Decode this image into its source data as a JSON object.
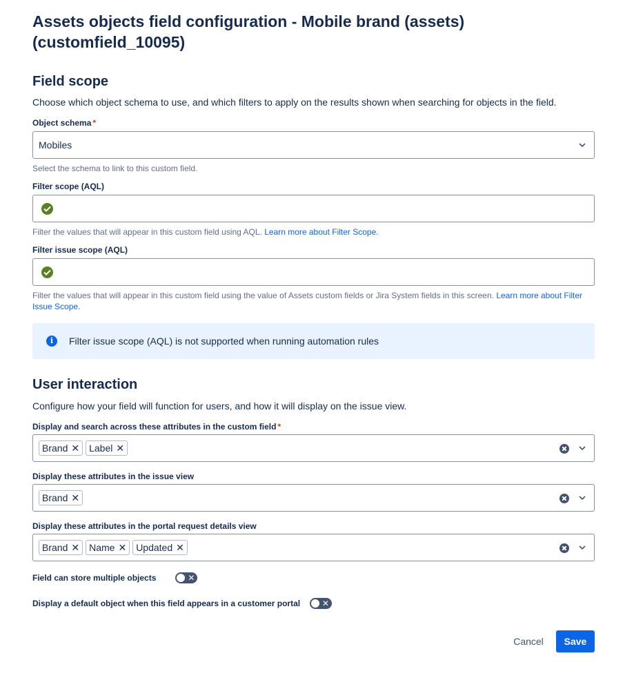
{
  "page": {
    "title": "Assets objects field configuration - Mobile brand (assets) (customfield_10095)"
  },
  "field_scope": {
    "heading": "Field scope",
    "description": "Choose which object schema to use, and which filters to apply on the results shown when searching for objects in the field.",
    "object_schema": {
      "label": "Object schema",
      "required_mark": "*",
      "value": "Mobiles",
      "helper": "Select the schema to link to this custom field."
    },
    "filter_scope": {
      "label": "Filter scope (AQL)",
      "status_icon": "check-circle-icon",
      "helper": "Filter the values that will appear in this custom field using AQL.",
      "link": "Learn more about Filter Scope."
    },
    "filter_issue_scope": {
      "label": "Filter issue scope (AQL)",
      "status_icon": "check-circle-icon",
      "helper": "Filter the values that will appear in this custom field using the value of Assets custom fields or Jira System fields in this screen.",
      "link": "Learn more about Filter Issue Scope."
    },
    "info_message": "Filter issue scope (AQL) is not supported when running automation rules"
  },
  "user_interaction": {
    "heading": "User interaction",
    "description": "Configure how your field will function for users, and how it will display on the issue view.",
    "display_search": {
      "label": "Display and search across these attributes in the custom field",
      "required_mark": "*",
      "chips": [
        "Brand",
        "Label"
      ]
    },
    "issue_view": {
      "label": "Display these attributes in the issue view",
      "chips": [
        "Brand"
      ]
    },
    "portal_view": {
      "label": "Display these attributes in the portal request details view",
      "chips": [
        "Brand",
        "Name",
        "Updated"
      ]
    },
    "multiple_objects": {
      "label": "Field can store multiple objects",
      "enabled": false
    },
    "default_object": {
      "label": "Display a default object when this field appears in a customer portal",
      "enabled": false
    }
  },
  "actions": {
    "cancel_label": "Cancel",
    "save_label": "Save"
  },
  "colors": {
    "primary": "#0c66e4",
    "success": "#5b7f24",
    "info_bg": "#e9f2ff",
    "required": "#de350b"
  }
}
